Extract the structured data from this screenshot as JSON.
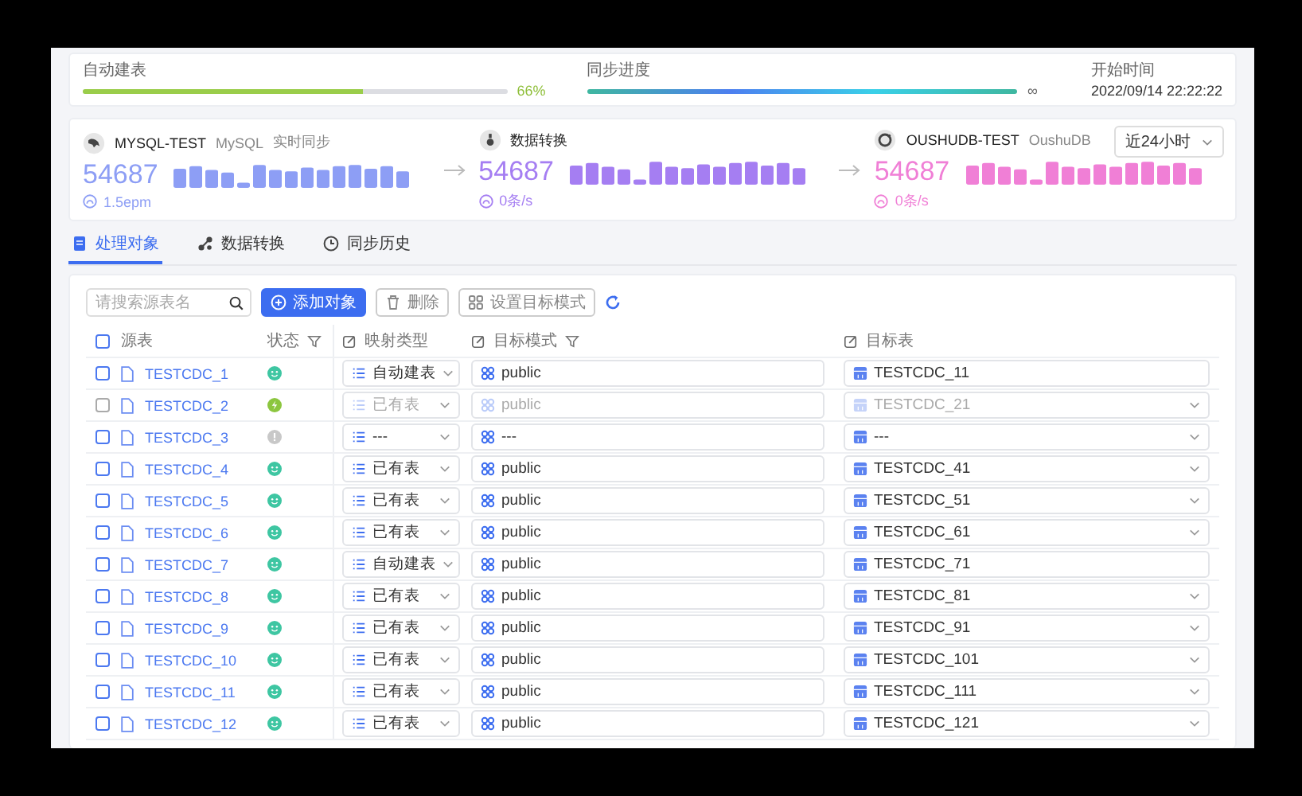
{
  "progress": [
    {
      "label": "自动建表",
      "kind": "solid",
      "level": 0.66,
      "reading": "66%"
    },
    {
      "label": "同步进度",
      "kind": "gradient",
      "level": 1,
      "reading": "∞"
    }
  ],
  "start_time": {
    "label": "开始时间",
    "value": "2022/09/14 22:22:22"
  },
  "flow": [
    {
      "kind": "source",
      "name": "MYSQL-TEST",
      "type": "MySQL",
      "mode": "实时同步",
      "count": "54687",
      "rate": "1.5epm",
      "color": "#8d9ef5"
    },
    {
      "kind": "transform",
      "name": "数据转换",
      "count": "54687",
      "rate": "0条/s",
      "color": "#a57ef2"
    },
    {
      "kind": "target",
      "name": "OUSHUDB-TEST",
      "type": "OushuDB",
      "count": "54687",
      "rate": "0条/s",
      "color": "#f07fd6"
    }
  ],
  "range_select": "近24小时",
  "tabs": [
    {
      "label": "处理对象",
      "kind": "objects",
      "selected": true
    },
    {
      "label": "数据转换",
      "kind": "transform",
      "selected": false
    },
    {
      "label": "同步历史",
      "kind": "history",
      "selected": false
    }
  ],
  "search": {
    "placeholder": "请搜索源表名"
  },
  "actions": [
    {
      "label": "添加对象",
      "kind": "add"
    },
    {
      "label": "删除",
      "kind": "delete"
    },
    {
      "label": "设置目标模式",
      "kind": "schema"
    }
  ],
  "select_all": {
    "checked": false
  },
  "columns": [
    {
      "label": "源表",
      "editable": false,
      "filter": false
    },
    {
      "label": "状态",
      "editable": false,
      "filter": true
    },
    {
      "label": "映射类型",
      "editable": true,
      "filter": false
    },
    {
      "label": "目标模式",
      "editable": true,
      "filter": true
    },
    {
      "label": "目标表",
      "editable": true,
      "filter": false
    }
  ],
  "rows": [
    {
      "checked": false,
      "disabled": false,
      "source": "TESTCDC_1",
      "kind": "success",
      "mapping": "自动建表",
      "schema": "public",
      "target": "TESTCDC_11",
      "target_dropdown": false
    },
    {
      "checked": false,
      "disabled": true,
      "source": "TESTCDC_2",
      "kind": "running",
      "mapping": "已有表",
      "schema": "public",
      "target": "TESTCDC_21",
      "target_dropdown": true
    },
    {
      "checked": false,
      "disabled": false,
      "source": "TESTCDC_3",
      "kind": "unknown",
      "mapping": "---",
      "schema": "---",
      "target": "---",
      "target_dropdown": true
    },
    {
      "checked": false,
      "disabled": false,
      "source": "TESTCDC_4",
      "kind": "success",
      "mapping": "已有表",
      "schema": "public",
      "target": "TESTCDC_41",
      "target_dropdown": true
    },
    {
      "checked": false,
      "disabled": false,
      "source": "TESTCDC_5",
      "kind": "success",
      "mapping": "已有表",
      "schema": "public",
      "target": "TESTCDC_51",
      "target_dropdown": true
    },
    {
      "checked": false,
      "disabled": false,
      "source": "TESTCDC_6",
      "kind": "success",
      "mapping": "已有表",
      "schema": "public",
      "target": "TESTCDC_61",
      "target_dropdown": true
    },
    {
      "checked": false,
      "disabled": false,
      "source": "TESTCDC_7",
      "kind": "success",
      "mapping": "自动建表",
      "schema": "public",
      "target": "TESTCDC_71",
      "target_dropdown": false
    },
    {
      "checked": false,
      "disabled": false,
      "source": "TESTCDC_8",
      "kind": "success",
      "mapping": "已有表",
      "schema": "public",
      "target": "TESTCDC_81",
      "target_dropdown": true
    },
    {
      "checked": false,
      "disabled": false,
      "source": "TESTCDC_9",
      "kind": "success",
      "mapping": "已有表",
      "schema": "public",
      "target": "TESTCDC_91",
      "target_dropdown": true
    },
    {
      "checked": false,
      "disabled": false,
      "source": "TESTCDC_10",
      "kind": "success",
      "mapping": "已有表",
      "schema": "public",
      "target": "TESTCDC_101",
      "target_dropdown": true
    },
    {
      "checked": false,
      "disabled": false,
      "source": "TESTCDC_11",
      "kind": "success",
      "mapping": "已有表",
      "schema": "public",
      "target": "TESTCDC_111",
      "target_dropdown": true
    },
    {
      "checked": false,
      "disabled": false,
      "source": "TESTCDC_12",
      "kind": "success",
      "mapping": "已有表",
      "schema": "public",
      "target": "TESTCDC_121",
      "target_dropdown": true
    }
  ]
}
